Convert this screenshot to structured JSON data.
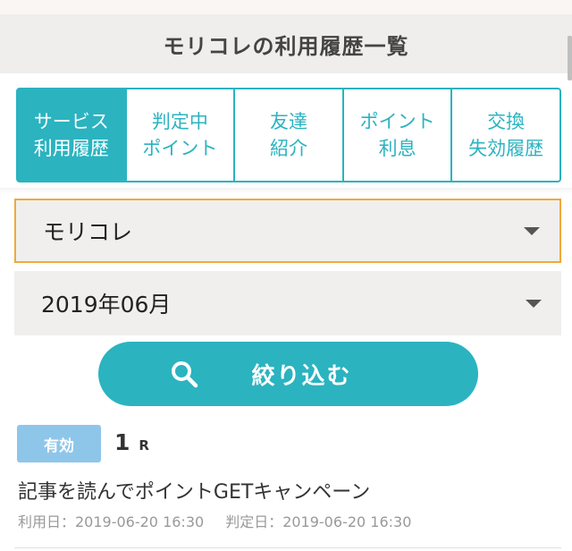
{
  "header": {
    "title": "モリコレの利用履歴一覧"
  },
  "tabs": [
    {
      "line1": "サービス",
      "line2": "利用履歴",
      "active": true
    },
    {
      "line1": "判定中",
      "line2": "ポイント",
      "active": false
    },
    {
      "line1": "友達",
      "line2": "紹介",
      "active": false
    },
    {
      "line1": "ポイント",
      "line2": "利息",
      "active": false
    },
    {
      "line1": "交換",
      "line2": "失効履歴",
      "active": false
    }
  ],
  "filters": {
    "service_value": "モリコレ",
    "month_value": "2019年06月"
  },
  "search": {
    "label": "絞り込む"
  },
  "history": {
    "status": "有効",
    "points": "1",
    "unit": "R",
    "title": "記事を読んでポイントGETキャンペーン",
    "use_date": "利用日：2019-06-20 16:30",
    "judge_date": "判定日：2019-06-20 16:30"
  },
  "colors": {
    "accent": "#2bb3c0",
    "badge": "#8ec6ea",
    "focus_border": "#f0a93a",
    "header_bg": "#efeeed"
  },
  "icons": {
    "search": "search-icon",
    "dropdown": "chevron-down-icon"
  }
}
